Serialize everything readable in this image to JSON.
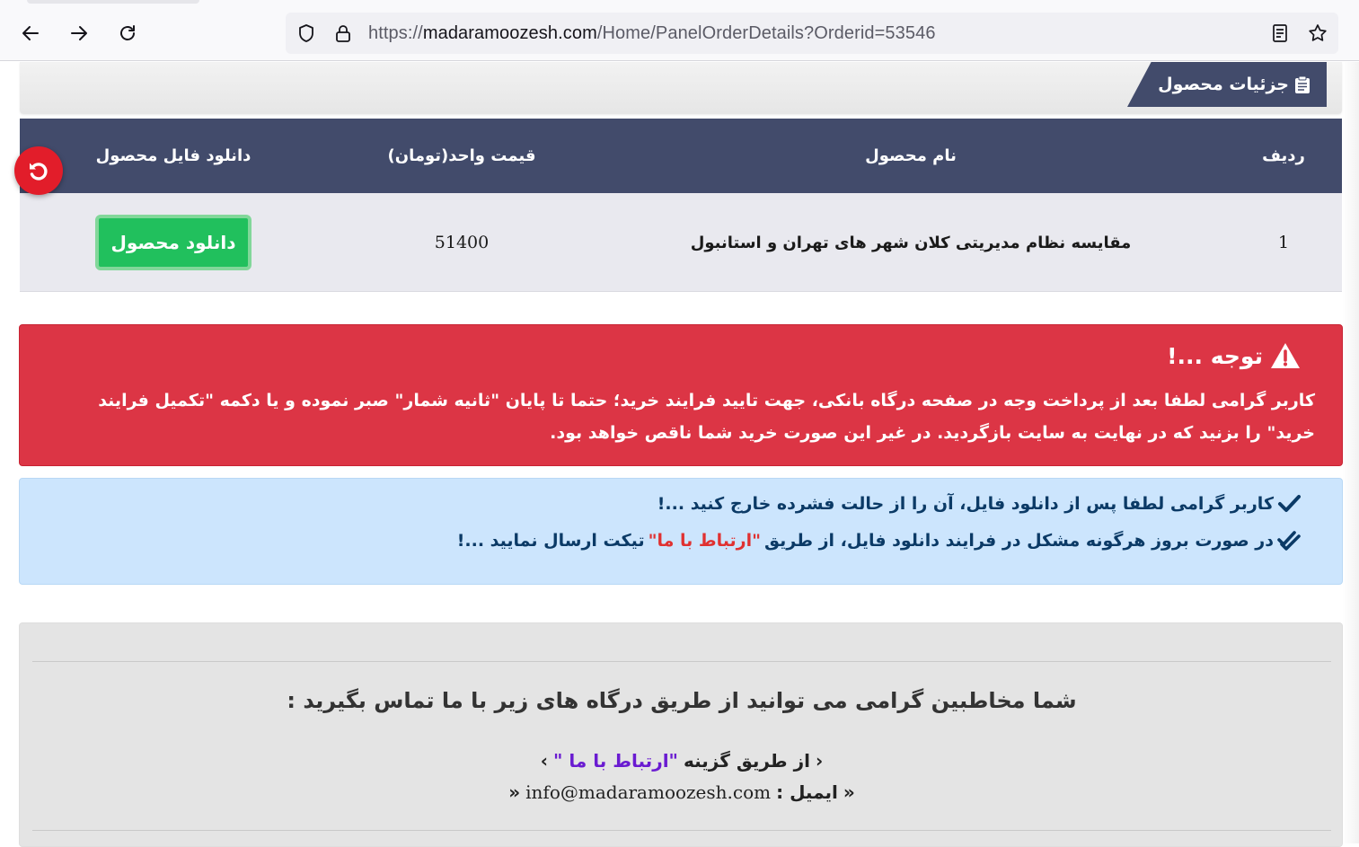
{
  "browser": {
    "url_scheme": "https://",
    "url_host": "madaramoozesh.com",
    "url_path": "/Home/PanelOrderDetails?Orderid=53546"
  },
  "header": {
    "title": "جزئیات محصول"
  },
  "table": {
    "columns": {
      "row": "ردیف",
      "name": "نام محصول",
      "price": "قیمت واحد(تومان)",
      "download": "دانلود فایل محصول"
    },
    "rows": [
      {
        "row": "1",
        "name": "مقایسه نظام مدیریتی کلان شهر های تهران و استانبول",
        "price": "51400",
        "download_label": "دانلود محصول"
      }
    ]
  },
  "alert_danger": {
    "title": "توجه ...!",
    "body": "کاربر گرامی لطفا بعد از پرداخت وجه در صفحه درگاه بانکی، جهت تایید فرایند خرید؛ حتما تا پایان \"ثانیه شمار\" صبر نموده و یا دکمه \"تکمیل فرایند خرید\" را بزنید که در نهایت به سایت بازگردید. در غیر این صورت خرید شما ناقص خواهد بود."
  },
  "alert_info": {
    "line1": "کاربر گرامی لطفا پس از دانلود فایل، آن را از حالت فشرده خارج کنید ...!",
    "line2_before": "در صورت بروز هرگونه مشکل در فرایند دانلود فایل، از طریق ",
    "line2_link": "\"ارتباط با ما\"",
    "line2_after": " تیکت ارسال نمایید ...!"
  },
  "contact": {
    "title": "شما مخاطبین گرامی می توانید از طریق درگاه های زیر با ما تماس بگیرید :",
    "option_prefix": "از طریق گزینه ",
    "option_link": "\"ارتباط با ما \"",
    "email_label": "ایمیل : ",
    "email": "info@madaramoozesh.com"
  },
  "colors": {
    "table_header": "#424b6b",
    "danger": "#dc3545",
    "info": "#cce5fd",
    "success": "#21c05d"
  }
}
